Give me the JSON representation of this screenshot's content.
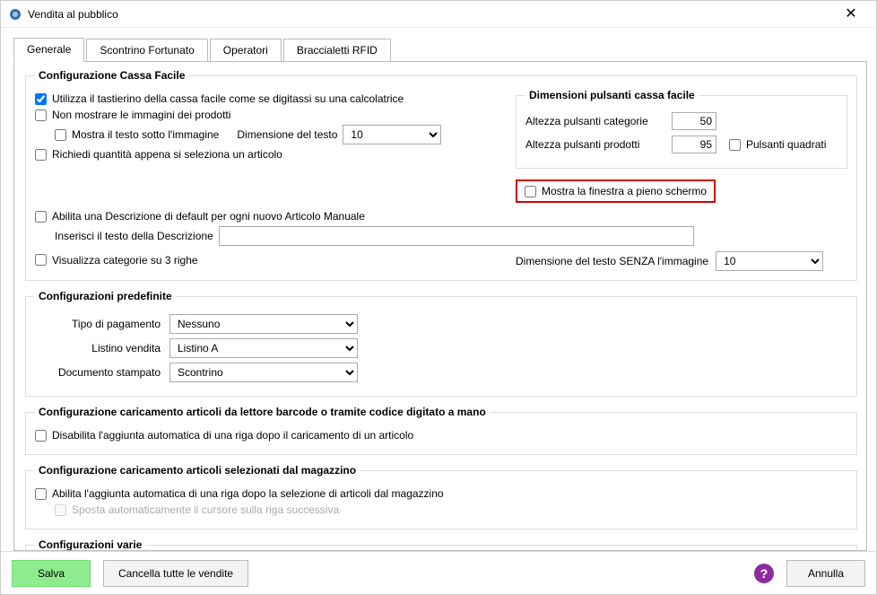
{
  "window": {
    "title": "Vendita al pubblico",
    "close_tooltip": "Chiudi"
  },
  "tabs": [
    {
      "label": "Generale"
    },
    {
      "label": "Scontrino Fortunato"
    },
    {
      "label": "Operatori"
    },
    {
      "label": "Braccialetti RFID"
    }
  ],
  "cassafacile": {
    "legend": "Configurazione Cassa Facile",
    "chk_tastierino": "Utilizza il tastierino della cassa facile come se digitassi su una calcolatrice",
    "chk_nonmostrare": "Non mostrare le immagini dei prodotti",
    "chk_testo_sotto": "Mostra il testo sotto l'immagine",
    "dim_testo_label": "Dimensione del testo",
    "dim_testo_value": "10",
    "chk_richiedi_qta": "Richiedi quantità appena si seleziona un articolo",
    "chk_abilita_descr": "Abilita una Descrizione di default per ogni nuovo Articolo Manuale",
    "descr_label": "Inserisci il testo della Descrizione",
    "descr_value": "",
    "chk_visualizza_cat3": "Visualizza categorie su 3 righe",
    "dim_testo_senza_label": "Dimensione del testo SENZA l'immagine",
    "dim_testo_senza_value": "10",
    "dimensioni": {
      "legend": "Dimensioni pulsanti cassa facile",
      "altezza_cat_label": "Altezza pulsanti categorie",
      "altezza_cat_value": "50",
      "altezza_prod_label": "Altezza pulsanti prodotti",
      "altezza_prod_value": "95",
      "chk_quadrati": "Pulsanti quadrati"
    },
    "chk_fullscreen": "Mostra la finestra a pieno schermo"
  },
  "predef": {
    "legend": "Configurazioni predefinite",
    "tipo_pag_label": "Tipo di pagamento",
    "tipo_pag_value": "Nessuno",
    "listino_label": "Listino vendita",
    "listino_value": "Listino A",
    "doc_label": "Documento stampato",
    "doc_value": "Scontrino"
  },
  "barcode": {
    "legend": "Configurazione caricamento articoli da lettore barcode o tramite codice digitato a mano",
    "chk_disabilita": "Disabilita l'aggiunta automatica di una riga dopo il caricamento di un articolo"
  },
  "magazzino": {
    "legend": "Configurazione caricamento articoli selezionati dal magazzino",
    "chk_abilita": "Abilita l'aggiunta automatica di una riga dopo la selezione di articoli dal magazzino",
    "chk_sposta": "Sposta automaticamente il cursore sulla riga successiva"
  },
  "varie": {
    "legend": "Configurazioni varie"
  },
  "footer": {
    "save": "Salva",
    "clear": "Cancella tutte le vendite",
    "cancel": "Annulla",
    "help": "?"
  }
}
